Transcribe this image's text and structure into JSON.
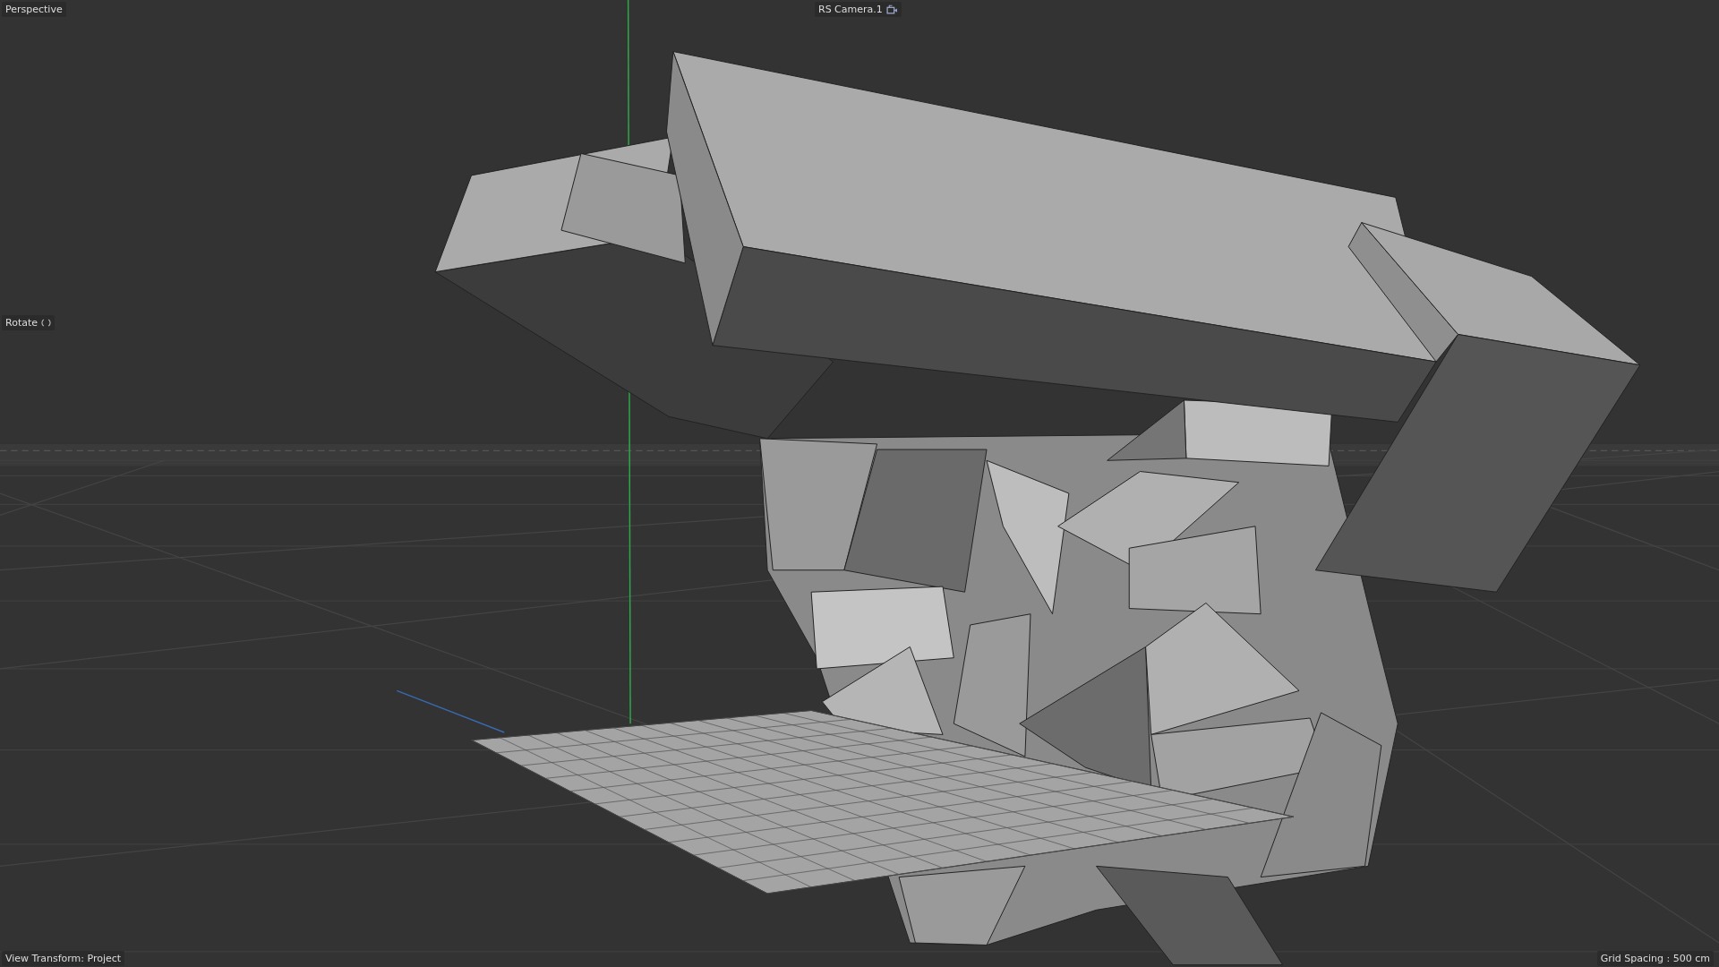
{
  "viewport": {
    "view_name": "Perspective",
    "camera": "RS Camera.1",
    "tool": "Rotate",
    "view_transform": "View Transform: Project",
    "grid_spacing": "Grid Spacing : 500 cm"
  }
}
